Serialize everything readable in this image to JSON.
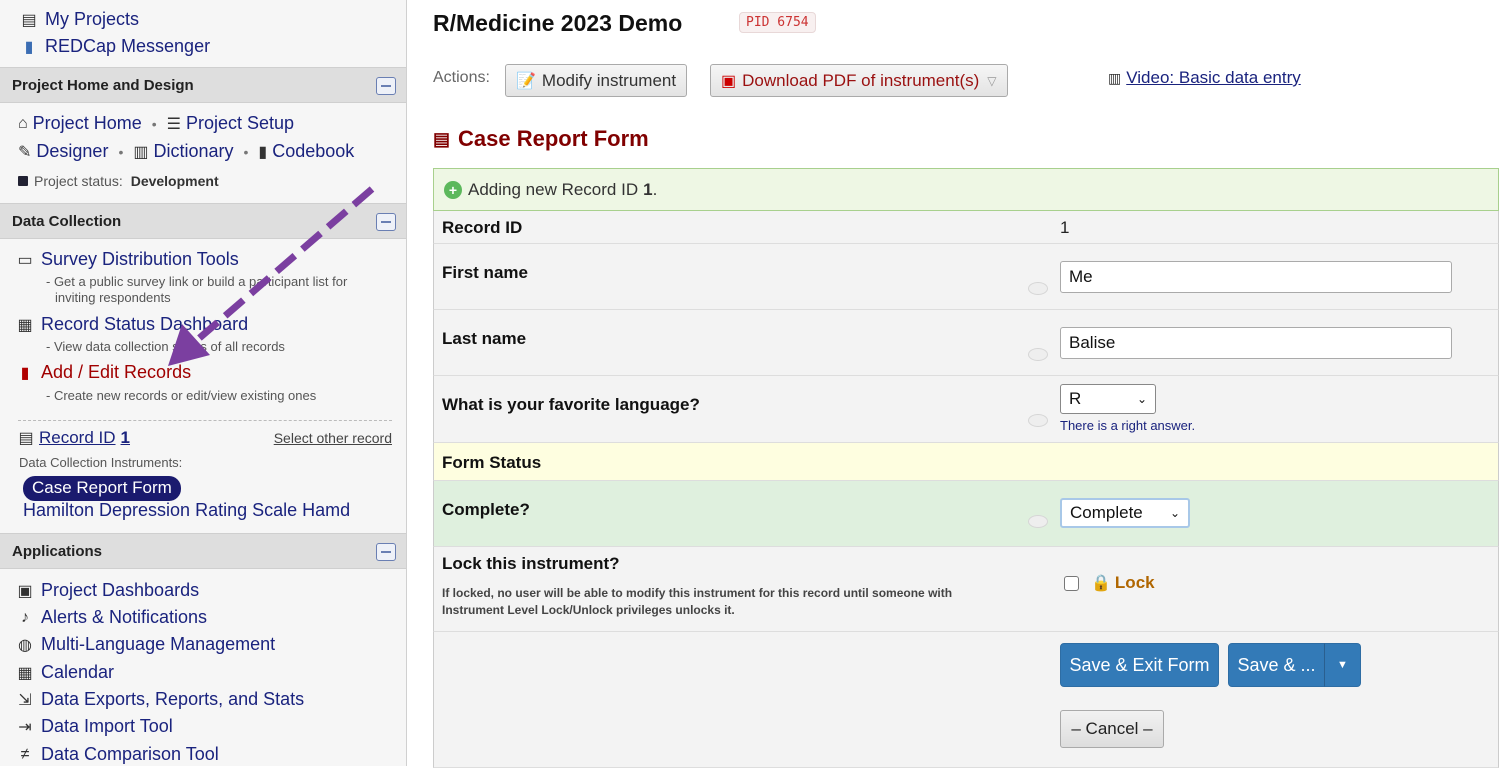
{
  "sidebar": {
    "top_links": [
      {
        "label": "My Projects",
        "icon": "list-icon"
      },
      {
        "label": "REDCap Messenger",
        "icon": "chat-icon"
      }
    ],
    "sections": {
      "project_home": {
        "title": "Project Home and Design"
      },
      "data_collection": {
        "title": "Data Collection"
      },
      "applications": {
        "title": "Applications"
      }
    },
    "project_home": {
      "project_home": "Project Home",
      "project_setup": "Project Setup",
      "designer": "Designer",
      "dictionary": "Dictionary",
      "codebook": "Codebook",
      "status_label": "Project status:",
      "status_value": "Development"
    },
    "data_collection": {
      "survey_tools": "Survey Distribution Tools",
      "survey_tools_desc_1": "- Get a public survey link or build a participant list for",
      "survey_tools_desc_2": "inviting respondents",
      "record_status": "Record Status Dashboard",
      "record_status_desc": "- View data collection status of all records",
      "add_edit": "Add / Edit Records",
      "add_edit_desc": "- Create new records or edit/view existing ones",
      "record_id_label": "Record ID",
      "record_id_value": "1",
      "select_other": "Select other record",
      "instruments_label": "Data Collection Instruments:",
      "instrument_active": "Case Report Form",
      "instrument_other": "Hamilton Depression Rating Scale Hamd"
    },
    "applications": [
      {
        "label": "Project Dashboards",
        "icon": "dashboard-icon"
      },
      {
        "label": "Alerts & Notifications",
        "icon": "bell-icon"
      },
      {
        "label": "Multi-Language Management",
        "icon": "globe-icon"
      },
      {
        "label": "Calendar",
        "icon": "calendar-icon"
      },
      {
        "label": "Data Exports, Reports, and Stats",
        "icon": "export-icon"
      },
      {
        "label": "Data Import Tool",
        "icon": "import-icon"
      },
      {
        "label": "Data Comparison Tool",
        "icon": "compare-icon"
      }
    ]
  },
  "header": {
    "title": "R/Medicine 2023 Demo",
    "pid": "PID 6754",
    "actions_label": "Actions:",
    "modify_instrument": "Modify instrument",
    "download_pdf": "Download PDF of instrument(s)",
    "video_link": "Video: Basic data entry"
  },
  "form": {
    "title": "Case Report Form",
    "banner_prefix": "Adding new Record ID",
    "banner_id": "1",
    "banner_suffix": ".",
    "fields": {
      "record_id_label": "Record ID",
      "record_id_value": "1",
      "first_name_label": "First name",
      "first_name_value": "Me",
      "last_name_label": "Last name",
      "last_name_value": "Balise",
      "language_label": "What is your favorite language?",
      "language_value": "R",
      "language_hint": "There is a right answer."
    },
    "status_header": "Form Status",
    "complete_label": "Complete?",
    "complete_value": "Complete",
    "lock_title": "Lock this instrument?",
    "lock_desc_1": "If locked, no user will be able to modify this instrument for this record until someone with",
    "lock_desc_2": "Instrument Level Lock/Unlock privileges unlocks it.",
    "lock_label": "Lock",
    "save_exit": "Save & Exit Form",
    "save_more": "Save & ...",
    "cancel": "– Cancel –"
  },
  "colors": {
    "accent_blue": "#337ab7",
    "form_title": "#800000",
    "annotation_arrow": "#7b3fa0"
  }
}
